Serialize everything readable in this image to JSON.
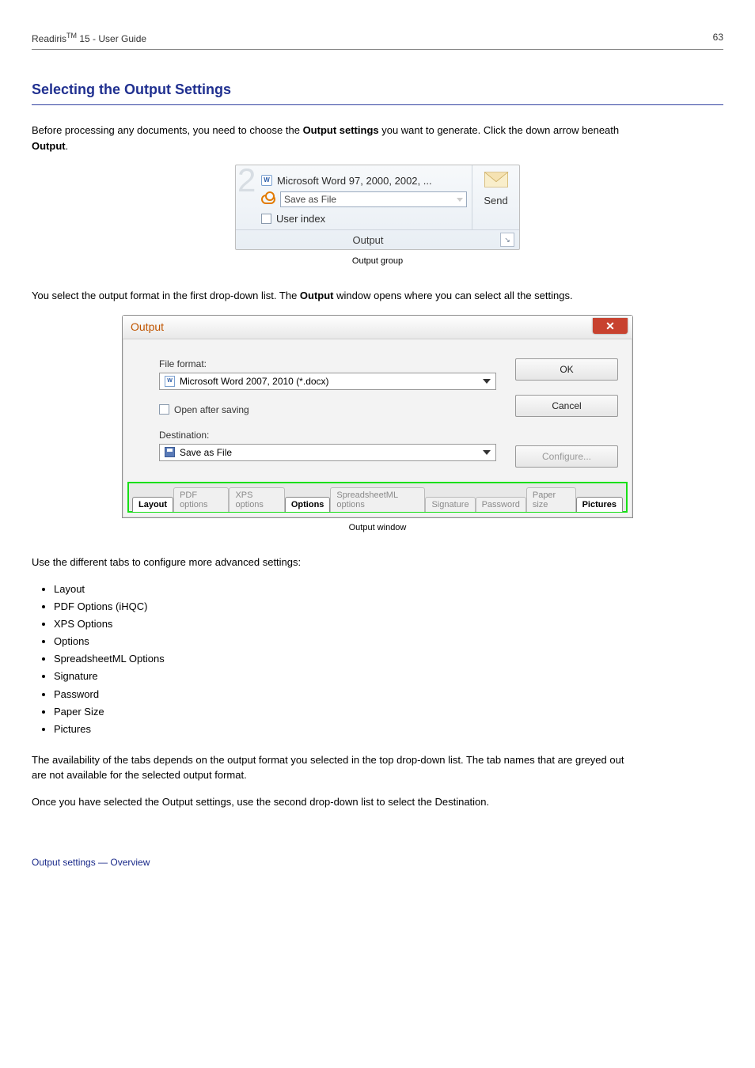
{
  "page_header": {
    "left": "Readiris",
    "tm": "TM",
    "left2": " 15 - User Guide",
    "right": "63"
  },
  "heading": "Selecting the Output Settings",
  "intro_pre": "Before processing any documents, you need to choose the ",
  "intro_bold": "Output settings",
  "intro_post": " you want to generate. Click the down arrow beneath ",
  "intro_bold2": "Output",
  "intro_tail": ".",
  "ribbon": {
    "word_label": "Microsoft Word 97, 2000, 2002, ...",
    "save_as": "Save as File",
    "user_index": "User index",
    "section_title": "Output",
    "send": "Send"
  },
  "caption1": "Output group",
  "para2_plain": "You select the output format in the first drop-down list. The ",
  "para2_bold": "Output",
  "para2_tail": " window opens where you can select all the settings.",
  "dialog": {
    "title": "Output",
    "ok": "OK",
    "cancel": "Cancel",
    "configure": "Configure...",
    "format_label": "File format:",
    "format_value": "Microsoft Word 2007, 2010 (*.docx)",
    "open_after": "Open after saving",
    "dest_label": "Destination:",
    "dest_value": "Save as File",
    "tabs": [
      "Layout",
      "PDF options",
      "XPS options",
      "Options",
      "SpreadsheetML options",
      "Signature",
      "Password",
      "Paper size",
      "Pictures"
    ]
  },
  "caption2": "Output window",
  "tabs_intro": "Use the different tabs to configure more advanced settings:",
  "tabs_list": [
    "Layout",
    "PDF Options (iHQC)",
    "XPS Options",
    "Options",
    "SpreadsheetML Options",
    "Signature",
    "Password",
    "Paper Size",
    "Pictures"
  ],
  "para3": "The availability of the tabs depends on the output format you selected in the top drop-down list. The tab names that are greyed out are not available for the selected output format.",
  "para4": "Once you have selected the Output settings, use the second drop-down list to select the Destination.",
  "footer": "Output settings — Overview"
}
